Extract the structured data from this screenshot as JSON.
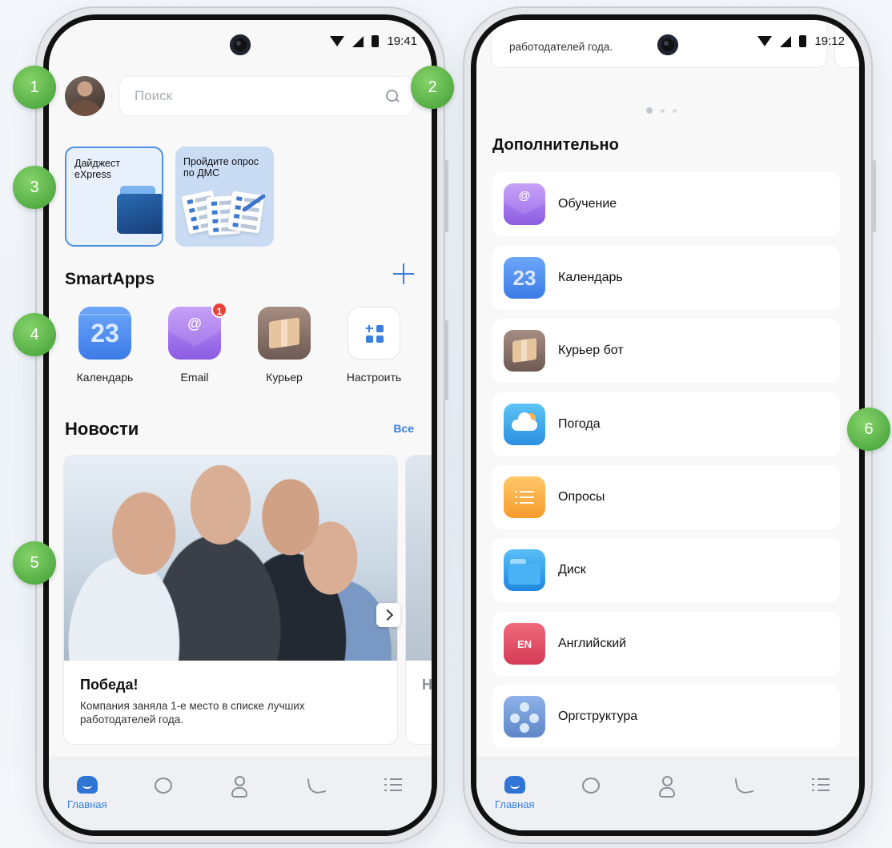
{
  "left_phone": {
    "status_time": "19:41",
    "search": {
      "placeholder": "Поиск"
    },
    "stories": [
      {
        "title": "Дайджест\neXpress"
      },
      {
        "title": "Пройдите опрос\nпо ДМС"
      }
    ],
    "smartapps": {
      "title": "SmartApps",
      "apps": [
        {
          "label": "Календарь",
          "icon": "calendar-icon",
          "number": "23"
        },
        {
          "label": "Email",
          "icon": "mail-icon",
          "badge": "1"
        },
        {
          "label": "Курьер",
          "icon": "box-icon"
        },
        {
          "label": "Настроить",
          "icon": "grid-plus-icon"
        }
      ]
    },
    "news": {
      "title": "Новости",
      "all_label": "Все",
      "card": {
        "title": "Победа!",
        "body": "Компания заняла 1-е место в списке лучших работодателей года."
      },
      "peek_letter": "Н"
    },
    "tabbar": {
      "home_label": "Главная"
    }
  },
  "right_phone": {
    "status_time": "19:12",
    "peek_text": "работодателей года.",
    "section_title": "Дополнительно",
    "items": [
      {
        "label": "Обучение",
        "icon": "mail-icon"
      },
      {
        "label": "Календарь",
        "icon": "calendar-icon",
        "number": "23"
      },
      {
        "label": "Курьер бот",
        "icon": "box-icon"
      },
      {
        "label": "Погода",
        "icon": "weather-icon"
      },
      {
        "label": "Опросы",
        "icon": "survey-icon"
      },
      {
        "label": "Диск",
        "icon": "folder-icon"
      },
      {
        "label": "Английский",
        "icon": "book-icon",
        "text": "EN"
      },
      {
        "label": "Оргструктура",
        "icon": "org-structure-icon"
      }
    ],
    "tabbar": {
      "home_label": "Главная"
    }
  },
  "markers": [
    "1",
    "2",
    "3",
    "4",
    "5",
    "6"
  ],
  "colors": {
    "accent": "#3a7fdd",
    "marker_green": "#4caf3a",
    "badge_red": "#e8413a"
  }
}
